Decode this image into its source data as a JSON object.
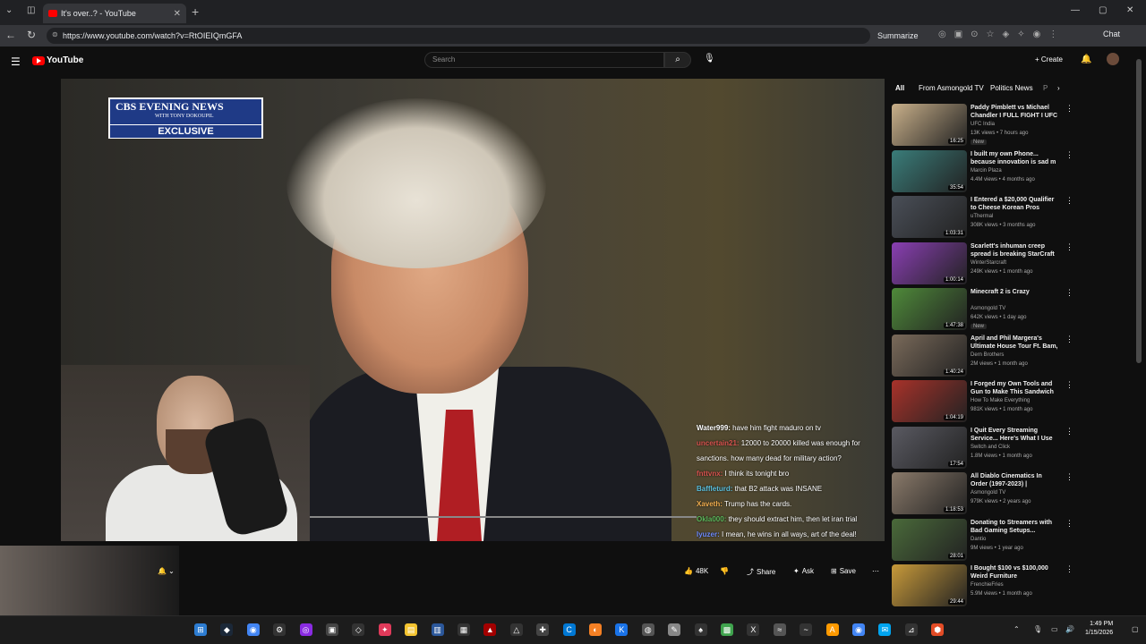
{
  "browser": {
    "tab_title": "It's over..? - YouTube",
    "url": "https://www.youtube.com/watch?v=RtOIEIQmGFA",
    "summarize_label": "Summarize",
    "chat_label": "Chat"
  },
  "youtube": {
    "logo_text": "YouTube",
    "search_placeholder": "Search",
    "create_label": "Create"
  },
  "video": {
    "badge_title": "CBS EVENING NEWS",
    "badge_subtitle": "WITH TONY DOKOUPIL",
    "badge_label": "EXCLUSIVE"
  },
  "chat": [
    {
      "user": "Water999:",
      "text": " have him fight maduro on tv",
      "color": "#ffffff"
    },
    {
      "user": "uncertain21:",
      "text": " 12000 to 20000 killed was enough for",
      "color": "#d9534f"
    },
    {
      "user": "",
      "text": "sanctions. how many dead for military action?",
      "color": "#ffffff"
    },
    {
      "user": "fnttvnx:",
      "text": " I think its tonight bro",
      "color": "#d9534f"
    },
    {
      "user": "Baffleturd:",
      "text": " that B2 attack was INSANE",
      "color": "#5bc0de"
    },
    {
      "user": "Xaveth:",
      "text": " Trump has the cards.",
      "color": "#f0ad4e"
    },
    {
      "user": "Okla000:",
      "text": " they should extract him, then let iran trial",
      "color": "#5cb85c"
    },
    {
      "user": "Iyuzer:",
      "text": " I mean, he wins in all ways, art of the deal!",
      "color": "#6f8cff"
    }
  ],
  "actions": {
    "likes": "48K",
    "share": "Share",
    "ask": "Ask",
    "save": "Save"
  },
  "filter_chips": [
    "All",
    "From Asmongold TV",
    "Politics News",
    "P"
  ],
  "recommendations": [
    {
      "title": "Paddy Pimblett vs Michael Chandler I FULL FIGHT I UFC ...",
      "channel": "UFC India",
      "meta": "13K views • 7 hours ago",
      "duration": "16:25",
      "new": "New",
      "color": "#c9b08a"
    },
    {
      "title": "I built my own Phone... because innovation is sad m",
      "channel": "Marcin Plaza",
      "meta": "4.4M views • 4 months ago",
      "duration": "35:54",
      "new": "",
      "color": "#3a7d7a"
    },
    {
      "title": "I Entered a $20,000 Qualifier to Cheese Korean Pros",
      "channel": "uThermal",
      "meta": "308K views • 3 months ago",
      "duration": "1:03:31",
      "new": "",
      "color": "#4a4f58"
    },
    {
      "title": "Scarlett's inhuman creep spread is breaking StarCraft 2.",
      "channel": "WinterStarcraft",
      "meta": "249K views • 1 month ago",
      "duration": "1:00:14",
      "new": "",
      "color": "#8a3fb3"
    },
    {
      "title": "Minecraft 2 is Crazy",
      "channel": "Asmongold TV",
      "meta": "642K views • 1 day ago",
      "duration": "1:47:38",
      "new": "New",
      "color": "#4f8a3a"
    },
    {
      "title": "April and Phil Margera's Ultimate House Tour Ft. Bam, ...",
      "channel": "Dern Brothers",
      "meta": "2M views • 1 month ago",
      "duration": "1:40:24",
      "new": "",
      "color": "#7a6a5a"
    },
    {
      "title": "I Forged my Own Tools and Gun to Make This Sandwich From ...",
      "channel": "How To Make Everything",
      "meta": "981K views • 1 month ago",
      "duration": "1:04:19",
      "new": "",
      "color": "#a8322a"
    },
    {
      "title": "I Quit Every Streaming Service... Here's What I Use Now.",
      "channel": "Switch and Click",
      "meta": "1.8M views • 1 month ago",
      "duration": "17:54",
      "new": "",
      "color": "#5a5a62"
    },
    {
      "title": "All Diablo Cinematics In Order (1997-2023) | Asmongold ...",
      "channel": "Asmongold TV",
      "meta": "979K views • 2 years ago",
      "duration": "1:18:53",
      "new": "",
      "color": "#8a7a6a"
    },
    {
      "title": "Donating to Streamers with Bad Gaming Setups...",
      "channel": "Dantio",
      "meta": "9M views • 1 year ago",
      "duration": "28:01",
      "new": "",
      "color": "#4a6a3a"
    },
    {
      "title": "I Bought $100 vs $100,000 Weird Furniture",
      "channel": "FrenchieFries",
      "meta": "5.9M views • 1 month ago",
      "duration": "29:44",
      "new": "",
      "color": "#c89a3a"
    }
  ],
  "taskbar": {
    "time": "1:49 PM",
    "date": "1/15/2026"
  }
}
